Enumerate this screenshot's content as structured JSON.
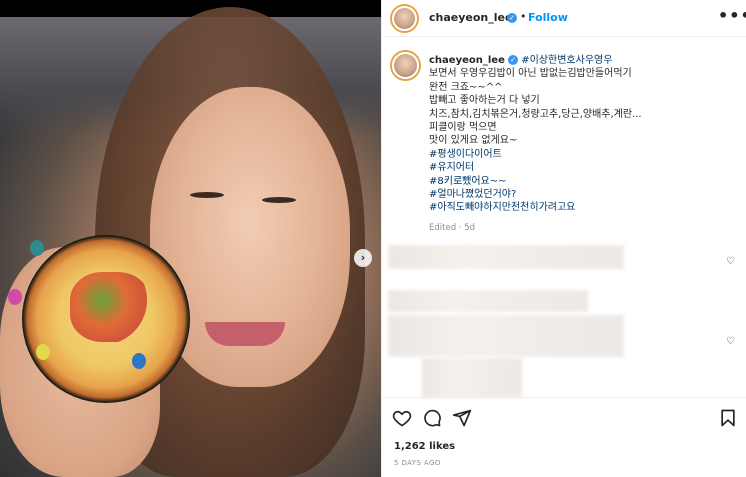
{
  "post": {
    "username": "chaeyeon_lee",
    "follow_label": "Follow",
    "dot": "•",
    "more_label": "•••"
  },
  "caption": {
    "username": "chaeyeon_lee",
    "first_tag": "#이상한변호사우영우",
    "lines": [
      "보면서 우영우김밥이 아닌 밥없는김밥만들어먹기",
      "완전 크죠~~^^",
      "밥빼고 좋아하는거 다 넣기",
      "치즈,참치,김치볶은거,청량고추,당근,양배추,계란...",
      "피클이랑 먹으면",
      "맛이 있게요 없게요~"
    ],
    "hashtags": [
      "#평생이다이어트",
      "#유지어터",
      "#8키로뺐어요~~",
      "#얼마나쪘었던거야?",
      "#아직도빼야하지만천천히가려고요"
    ],
    "edited": "Edited · 5d"
  },
  "footer": {
    "likes": "1,262 likes",
    "time_ago": "5 DAYS AGO"
  },
  "media": {
    "next_arrow": "›"
  },
  "colors": {
    "accent": "#0095f6",
    "hashtag": "#00376b",
    "verified": "#3897f0"
  },
  "icons": [
    "verified-badge-icon",
    "more-options-icon",
    "heart-icon",
    "comment-icon",
    "share-icon",
    "bookmark-icon",
    "next-arrow-icon"
  ]
}
